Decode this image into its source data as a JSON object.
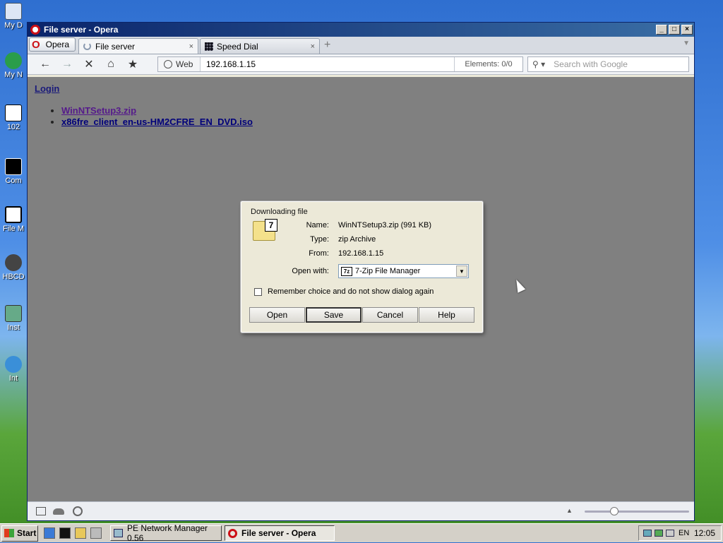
{
  "desktop": {
    "icons": [
      {
        "label": "My D",
        "name": "desktop-icon-my-documents"
      },
      {
        "label": "My N",
        "name": "desktop-icon-my-network"
      },
      {
        "label": "102",
        "name": "desktop-icon-102"
      },
      {
        "label": "Com",
        "name": "desktop-icon-command"
      },
      {
        "label": "File M",
        "name": "desktop-icon-file-manager"
      },
      {
        "label": "HBCD",
        "name": "desktop-icon-hbcd"
      },
      {
        "label": "Inst",
        "name": "desktop-icon-install"
      },
      {
        "label": "Int",
        "name": "desktop-icon-internet"
      }
    ]
  },
  "window": {
    "title": "File server - Opera",
    "controls": {
      "minimize": "_",
      "maximize": "□",
      "close": "×"
    }
  },
  "tabs": {
    "menu_label": "Opera",
    "items": [
      {
        "label": "File server",
        "close": "×",
        "active": true
      },
      {
        "label": "Speed Dial",
        "close": "×",
        "active": false
      }
    ],
    "new_tab": "+"
  },
  "toolbar": {
    "back": "←",
    "forward": "→",
    "stop": "✕",
    "home": "⌂",
    "bookmark": "★",
    "address_label": "Web",
    "url": "192.168.1.15",
    "elements": "Elements:  0/0",
    "search_placeholder": "Search with Google"
  },
  "page": {
    "login": "Login",
    "files": [
      {
        "name": "WinNTSetup3.zip",
        "visited": true
      },
      {
        "name": "x86fre_client_en-us-HM2CFRE_EN_DVD.iso",
        "visited": false
      }
    ]
  },
  "dialog": {
    "title": "Downloading file",
    "name_label": "Name:",
    "name_value": "WinNTSetup3.zip (991 KB)",
    "type_label": "Type:",
    "type_value": "zip Archive",
    "from_label": "From:",
    "from_value": "192.168.1.15",
    "openwith_label": "Open with:",
    "openwith_value": "7-Zip File Manager",
    "remember": "Remember choice and do not show dialog again",
    "buttons": {
      "open": "Open",
      "save": "Save",
      "cancel": "Cancel",
      "help": "Help"
    },
    "file_badge": "7",
    "app_badge": "7z"
  },
  "taskbar": {
    "start": "Start",
    "tasks": [
      {
        "label": "PE Network Manager 0.56",
        "active": false
      },
      {
        "label": "File server - Opera",
        "active": true
      }
    ],
    "lang": "EN",
    "clock": "12:05"
  }
}
